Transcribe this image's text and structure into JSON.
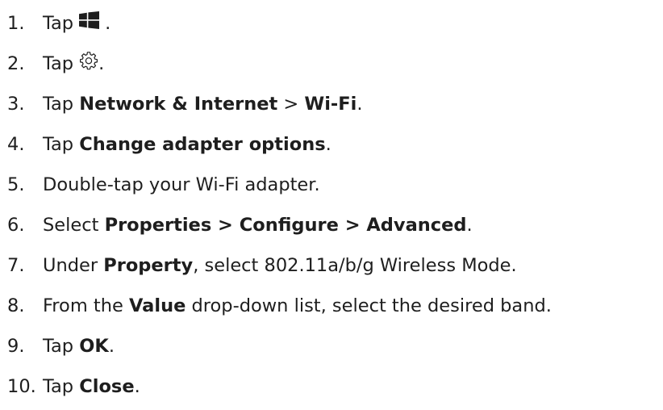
{
  "steps": [
    {
      "number": "1.",
      "parts": {
        "a": "Tap",
        "b": "."
      },
      "icon": "windows-start-icon"
    },
    {
      "number": "2.",
      "parts": {
        "a": "Tap",
        "b": "."
      },
      "icon": "settings-gear-icon"
    },
    {
      "number": "3.",
      "parts": {
        "a": "Tap ",
        "b": "Network & Internet",
        "c": " > ",
        "d": "Wi-Fi",
        "e": "."
      }
    },
    {
      "number": "4.",
      "parts": {
        "a": "Tap ",
        "b": "Change adapter options",
        "c": "."
      }
    },
    {
      "number": "5.",
      "parts": {
        "a": "Double-tap your Wi-Fi adapter."
      }
    },
    {
      "number": "6.",
      "parts": {
        "a": "Select ",
        "b": "Properties > Configure > Advanced",
        "c": "."
      }
    },
    {
      "number": "7.",
      "parts": {
        "a": "Under ",
        "b": "Property",
        "c": ", select 802.11a/b/g Wireless Mode."
      }
    },
    {
      "number": "8.",
      "parts": {
        "a": "From the ",
        "b": "Value",
        "c": " drop-down list, select the desired band."
      }
    },
    {
      "number": "9.",
      "parts": {
        "a": "Tap ",
        "b": "OK",
        "c": "."
      }
    },
    {
      "number": "10.",
      "parts": {
        "a": "Tap ",
        "b": "Close",
        "c": "."
      }
    }
  ]
}
